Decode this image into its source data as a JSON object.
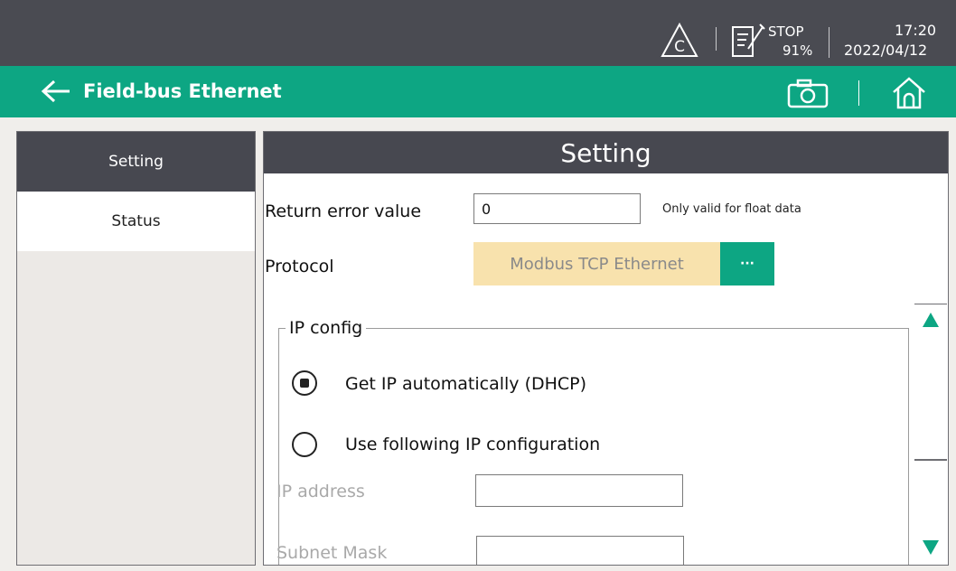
{
  "status_bar": {
    "warning_icon_letter": "C",
    "plc_state": "STOP",
    "percent": "91%",
    "time": "17:20",
    "date": "2022/04/12"
  },
  "title_bar": {
    "title": "Field-bus Ethernet"
  },
  "nav": {
    "items": [
      {
        "label": "Setting",
        "active": true
      },
      {
        "label": "Status",
        "active": false
      }
    ]
  },
  "panel": {
    "header": "Setting",
    "return_error": {
      "label": "Return error value",
      "value": "0",
      "note": "Only valid for float data"
    },
    "protocol": {
      "label": "Protocol",
      "value": "Modbus TCP Ethernet",
      "button_label": "···"
    },
    "ip_config": {
      "legend": "IP config",
      "options": [
        {
          "label": "Get IP automatically (DHCP)",
          "selected": true
        },
        {
          "label": "Use following IP configuration",
          "selected": false
        }
      ],
      "fields": [
        {
          "label": "IP address",
          "value": ""
        },
        {
          "label": "Subnet Mask",
          "value": ""
        }
      ]
    }
  },
  "colors": {
    "accent": "#0da683",
    "status_bar": "#4a4b52",
    "header": "#474850",
    "protocol_field": "#f8e2ad"
  }
}
